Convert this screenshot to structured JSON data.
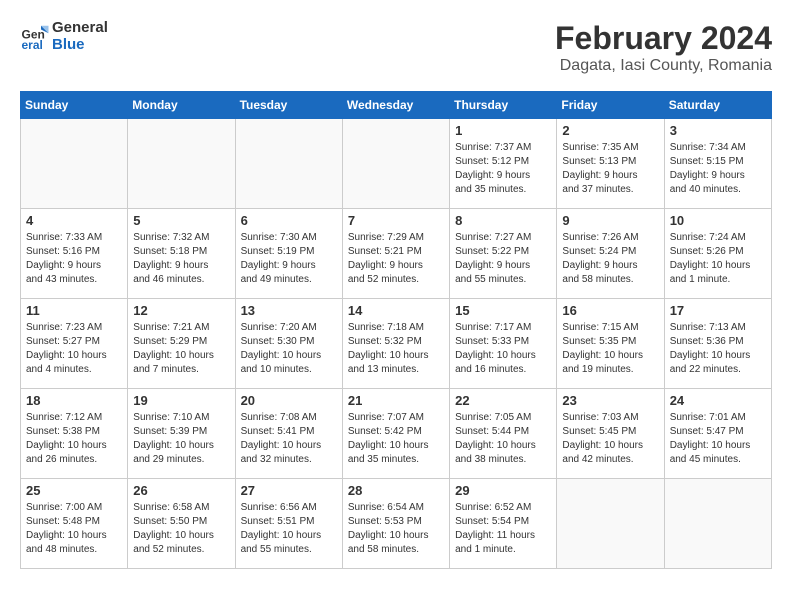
{
  "header": {
    "logo_line1": "General",
    "logo_line2": "Blue",
    "month_year": "February 2024",
    "location": "Dagata, Iasi County, Romania"
  },
  "days_of_week": [
    "Sunday",
    "Monday",
    "Tuesday",
    "Wednesday",
    "Thursday",
    "Friday",
    "Saturday"
  ],
  "weeks": [
    [
      {
        "day": "",
        "info": ""
      },
      {
        "day": "",
        "info": ""
      },
      {
        "day": "",
        "info": ""
      },
      {
        "day": "",
        "info": ""
      },
      {
        "day": "1",
        "info": "Sunrise: 7:37 AM\nSunset: 5:12 PM\nDaylight: 9 hours\nand 35 minutes."
      },
      {
        "day": "2",
        "info": "Sunrise: 7:35 AM\nSunset: 5:13 PM\nDaylight: 9 hours\nand 37 minutes."
      },
      {
        "day": "3",
        "info": "Sunrise: 7:34 AM\nSunset: 5:15 PM\nDaylight: 9 hours\nand 40 minutes."
      }
    ],
    [
      {
        "day": "4",
        "info": "Sunrise: 7:33 AM\nSunset: 5:16 PM\nDaylight: 9 hours\nand 43 minutes."
      },
      {
        "day": "5",
        "info": "Sunrise: 7:32 AM\nSunset: 5:18 PM\nDaylight: 9 hours\nand 46 minutes."
      },
      {
        "day": "6",
        "info": "Sunrise: 7:30 AM\nSunset: 5:19 PM\nDaylight: 9 hours\nand 49 minutes."
      },
      {
        "day": "7",
        "info": "Sunrise: 7:29 AM\nSunset: 5:21 PM\nDaylight: 9 hours\nand 52 minutes."
      },
      {
        "day": "8",
        "info": "Sunrise: 7:27 AM\nSunset: 5:22 PM\nDaylight: 9 hours\nand 55 minutes."
      },
      {
        "day": "9",
        "info": "Sunrise: 7:26 AM\nSunset: 5:24 PM\nDaylight: 9 hours\nand 58 minutes."
      },
      {
        "day": "10",
        "info": "Sunrise: 7:24 AM\nSunset: 5:26 PM\nDaylight: 10 hours\nand 1 minute."
      }
    ],
    [
      {
        "day": "11",
        "info": "Sunrise: 7:23 AM\nSunset: 5:27 PM\nDaylight: 10 hours\nand 4 minutes."
      },
      {
        "day": "12",
        "info": "Sunrise: 7:21 AM\nSunset: 5:29 PM\nDaylight: 10 hours\nand 7 minutes."
      },
      {
        "day": "13",
        "info": "Sunrise: 7:20 AM\nSunset: 5:30 PM\nDaylight: 10 hours\nand 10 minutes."
      },
      {
        "day": "14",
        "info": "Sunrise: 7:18 AM\nSunset: 5:32 PM\nDaylight: 10 hours\nand 13 minutes."
      },
      {
        "day": "15",
        "info": "Sunrise: 7:17 AM\nSunset: 5:33 PM\nDaylight: 10 hours\nand 16 minutes."
      },
      {
        "day": "16",
        "info": "Sunrise: 7:15 AM\nSunset: 5:35 PM\nDaylight: 10 hours\nand 19 minutes."
      },
      {
        "day": "17",
        "info": "Sunrise: 7:13 AM\nSunset: 5:36 PM\nDaylight: 10 hours\nand 22 minutes."
      }
    ],
    [
      {
        "day": "18",
        "info": "Sunrise: 7:12 AM\nSunset: 5:38 PM\nDaylight: 10 hours\nand 26 minutes."
      },
      {
        "day": "19",
        "info": "Sunrise: 7:10 AM\nSunset: 5:39 PM\nDaylight: 10 hours\nand 29 minutes."
      },
      {
        "day": "20",
        "info": "Sunrise: 7:08 AM\nSunset: 5:41 PM\nDaylight: 10 hours\nand 32 minutes."
      },
      {
        "day": "21",
        "info": "Sunrise: 7:07 AM\nSunset: 5:42 PM\nDaylight: 10 hours\nand 35 minutes."
      },
      {
        "day": "22",
        "info": "Sunrise: 7:05 AM\nSunset: 5:44 PM\nDaylight: 10 hours\nand 38 minutes."
      },
      {
        "day": "23",
        "info": "Sunrise: 7:03 AM\nSunset: 5:45 PM\nDaylight: 10 hours\nand 42 minutes."
      },
      {
        "day": "24",
        "info": "Sunrise: 7:01 AM\nSunset: 5:47 PM\nDaylight: 10 hours\nand 45 minutes."
      }
    ],
    [
      {
        "day": "25",
        "info": "Sunrise: 7:00 AM\nSunset: 5:48 PM\nDaylight: 10 hours\nand 48 minutes."
      },
      {
        "day": "26",
        "info": "Sunrise: 6:58 AM\nSunset: 5:50 PM\nDaylight: 10 hours\nand 52 minutes."
      },
      {
        "day": "27",
        "info": "Sunrise: 6:56 AM\nSunset: 5:51 PM\nDaylight: 10 hours\nand 55 minutes."
      },
      {
        "day": "28",
        "info": "Sunrise: 6:54 AM\nSunset: 5:53 PM\nDaylight: 10 hours\nand 58 minutes."
      },
      {
        "day": "29",
        "info": "Sunrise: 6:52 AM\nSunset: 5:54 PM\nDaylight: 11 hours\nand 1 minute."
      },
      {
        "day": "",
        "info": ""
      },
      {
        "day": "",
        "info": ""
      }
    ]
  ]
}
